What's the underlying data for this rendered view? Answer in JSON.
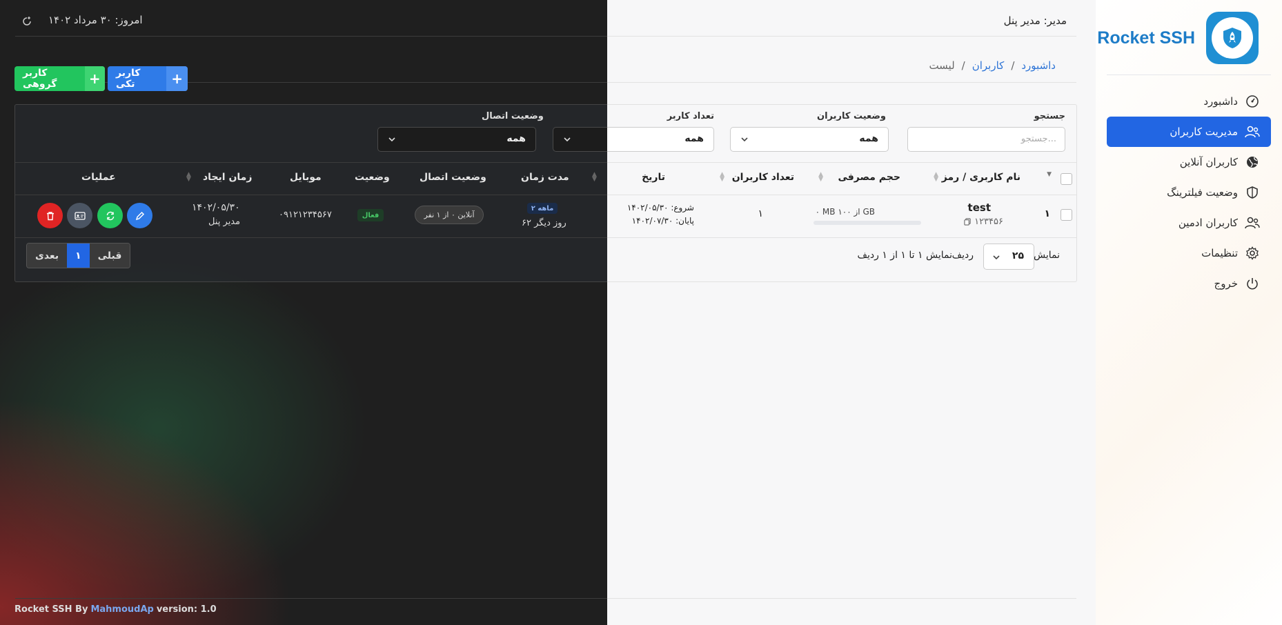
{
  "brand": {
    "name": "Rocket SSH"
  },
  "sidebar": {
    "items": [
      {
        "label": "داشبورد",
        "icon": "dashboard-gauge-icon"
      },
      {
        "label": "مدیریت کاربران",
        "icon": "users-manage-icon",
        "active": true
      },
      {
        "label": "کاربران آنلاین",
        "icon": "globe-icon"
      },
      {
        "label": "وضعیت فیلترینگ",
        "icon": "shield-icon"
      },
      {
        "label": "کاربران ادمین",
        "icon": "admin-users-icon"
      },
      {
        "label": "تنظیمات",
        "icon": "gear-icon"
      },
      {
        "label": "خروج",
        "icon": "power-icon"
      }
    ]
  },
  "header": {
    "admin": "مدیر: مدیر پنل",
    "today": "امروز: ۳۰ مرداد ۱۴۰۲"
  },
  "breadcrumb": {
    "home": "داشبورد",
    "section": "کاربران",
    "page": "لیست",
    "sep": "/"
  },
  "actions": {
    "single_user": "کاربر تکی",
    "group_user": "کاربر گروهی"
  },
  "filters": {
    "search_label": "جستجو",
    "search_placeholder": "جستجو...",
    "user_status_label": "وضعیت کاربران",
    "user_status_value": "همه",
    "user_count_label": "تعداد کاربر",
    "user_count_value": "همه",
    "connection_label": "وضعیت اتصال",
    "connection_value": "همه"
  },
  "table": {
    "headers": {
      "username": "نام کاربری / رمز",
      "traffic": "حجم مصرفی",
      "user_count": "تعداد کاربران",
      "date": "تاریخ",
      "duration": "مدت زمان",
      "connection": "وضعیت اتصال",
      "status": "وضعیت",
      "mobile": "موبایل",
      "created": "زمان ایجاد",
      "operations": "عملیات"
    },
    "row": {
      "index": "۱",
      "username": "test",
      "password": "۱۲۳۴۵۶",
      "traffic": "۰ MB از ۱۰۰ GB",
      "traffic_fraction": 0,
      "user_count": "۱",
      "start": "شروع: ۱۴۰۲/۰۵/۳۰",
      "end": "پایان: ۱۴۰۲/۰۷/۳۰",
      "duration_badge": "۲ ماهه",
      "remaining": "۶۲ روز دیگر",
      "connection": "آنلاین ۰ از ۱ نفر",
      "status": "فعال",
      "mobile": "۰۹۱۲۱۲۳۴۵۶۷",
      "created_date": "۱۴۰۲/۰۵/۳۰",
      "created_by": "مدیر پنل"
    }
  },
  "pagination": {
    "show": "نمایش",
    "per_page": "۲۵",
    "rows": "ردیف",
    "summary": "نمایش ۱ تا ۱ از ۱ ردیف",
    "prev": "قبلی",
    "current": "۱",
    "next": "بعدی"
  },
  "footer": {
    "prefix": "Rocket SSH By",
    "author": "MahmoudAp",
    "version": "version: 1.0"
  },
  "colors": {
    "primary": "#2266e3",
    "success": "#22c55e",
    "danger": "#e02424",
    "brand": "#1d7cc7"
  }
}
